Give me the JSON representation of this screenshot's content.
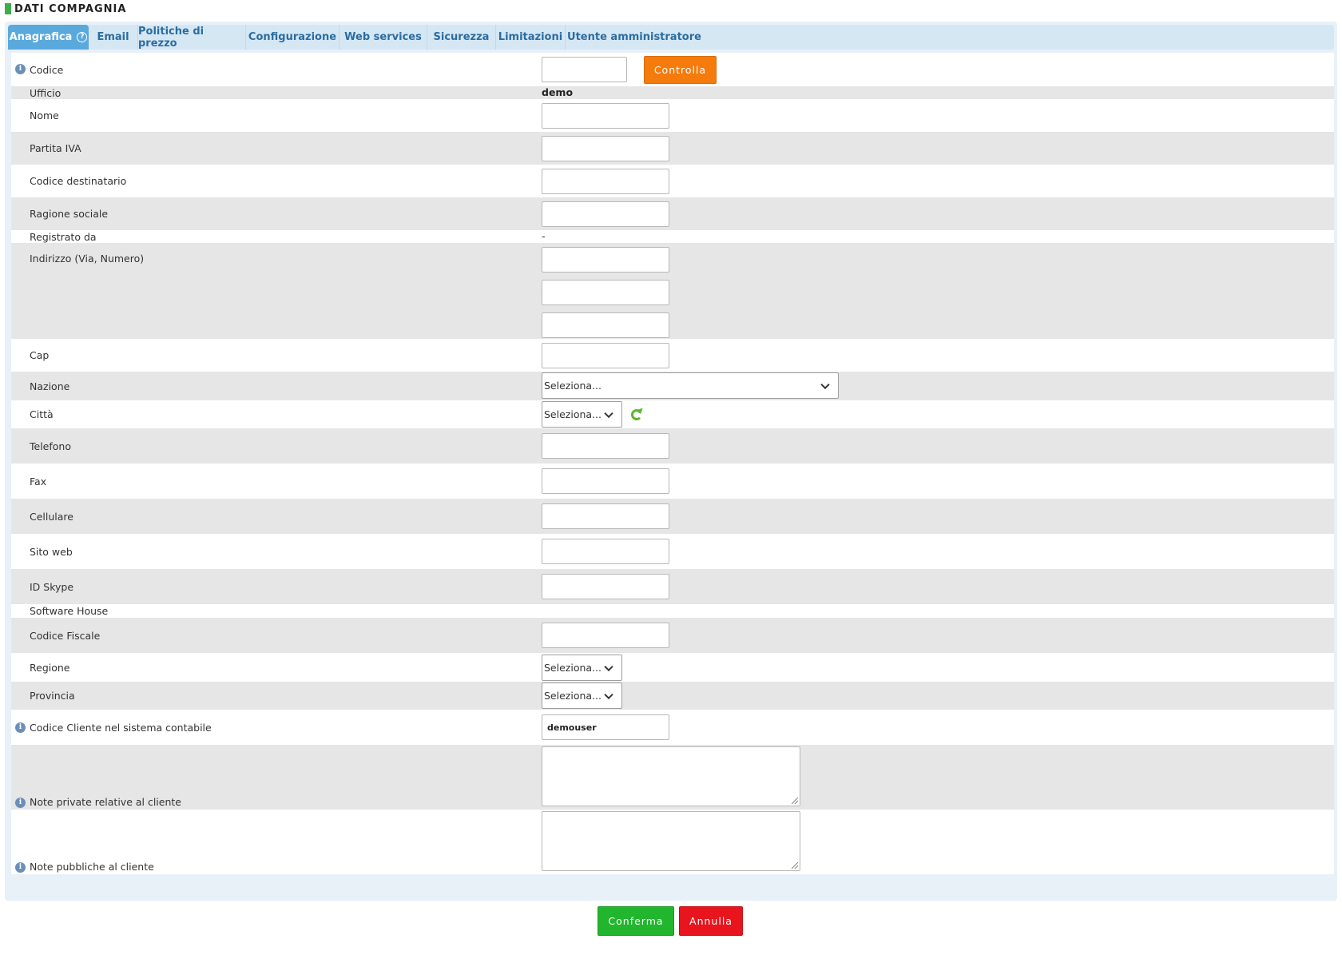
{
  "header": {
    "title": "DATI COMPAGNIA"
  },
  "tabs": [
    {
      "label": "Anagrafica",
      "active": true
    },
    {
      "label": "Email"
    },
    {
      "label": "Politiche di prezzo"
    },
    {
      "label": "Configurazione"
    },
    {
      "label": "Web services"
    },
    {
      "label": "Sicurezza"
    },
    {
      "label": "Limitazioni"
    },
    {
      "label": "Utente amministratore"
    }
  ],
  "tab_help_icon": "?",
  "form": {
    "codice": {
      "label": "Codice",
      "button": "Controlla",
      "value": ""
    },
    "ufficio": {
      "label": "Ufficio",
      "value": "demo"
    },
    "nome": {
      "label": "Nome",
      "value": ""
    },
    "partita_iva": {
      "label": "Partita IVA",
      "value": ""
    },
    "codice_destinatario": {
      "label": "Codice destinatario",
      "value": ""
    },
    "ragione_sociale": {
      "label": "Ragione sociale",
      "value": ""
    },
    "registrato_da": {
      "label": "Registrato da",
      "value": "-"
    },
    "indirizzo": {
      "label": "Indirizzo (Via, Numero)",
      "values": [
        "",
        "",
        ""
      ]
    },
    "cap": {
      "label": "Cap",
      "value": ""
    },
    "nazione": {
      "label": "Nazione",
      "selected": "Seleziona..."
    },
    "citta": {
      "label": "Città",
      "selected": "Seleziona..."
    },
    "telefono": {
      "label": "Telefono",
      "value": ""
    },
    "fax": {
      "label": "Fax",
      "value": ""
    },
    "cellulare": {
      "label": "Cellulare",
      "value": ""
    },
    "sito_web": {
      "label": "Sito web",
      "value": ""
    },
    "id_skype": {
      "label": "ID Skype",
      "value": ""
    },
    "software_house": {
      "label": "Software House"
    },
    "codice_fiscale": {
      "label": "Codice Fiscale",
      "value": ""
    },
    "regione": {
      "label": "Regione",
      "selected": "Seleziona..."
    },
    "provincia": {
      "label": "Provincia",
      "selected": "Seleziona..."
    },
    "codice_cliente": {
      "label": "Codice Cliente nel sistema contabile",
      "value": "demouser"
    },
    "note_private": {
      "label": "Note private relative al cliente",
      "value": ""
    },
    "note_pubbliche": {
      "label": "Note pubbliche al cliente",
      "value": ""
    }
  },
  "info_icon": "i",
  "footer": {
    "confirm_label": "Conferma",
    "cancel_label": "Annulla"
  },
  "colors": {
    "accent_orange": "#f47b0c",
    "confirm_green": "#22b52e",
    "cancel_red": "#e8141e",
    "tab_active": "#5aa9dd",
    "tab_text": "#2a6da0"
  }
}
